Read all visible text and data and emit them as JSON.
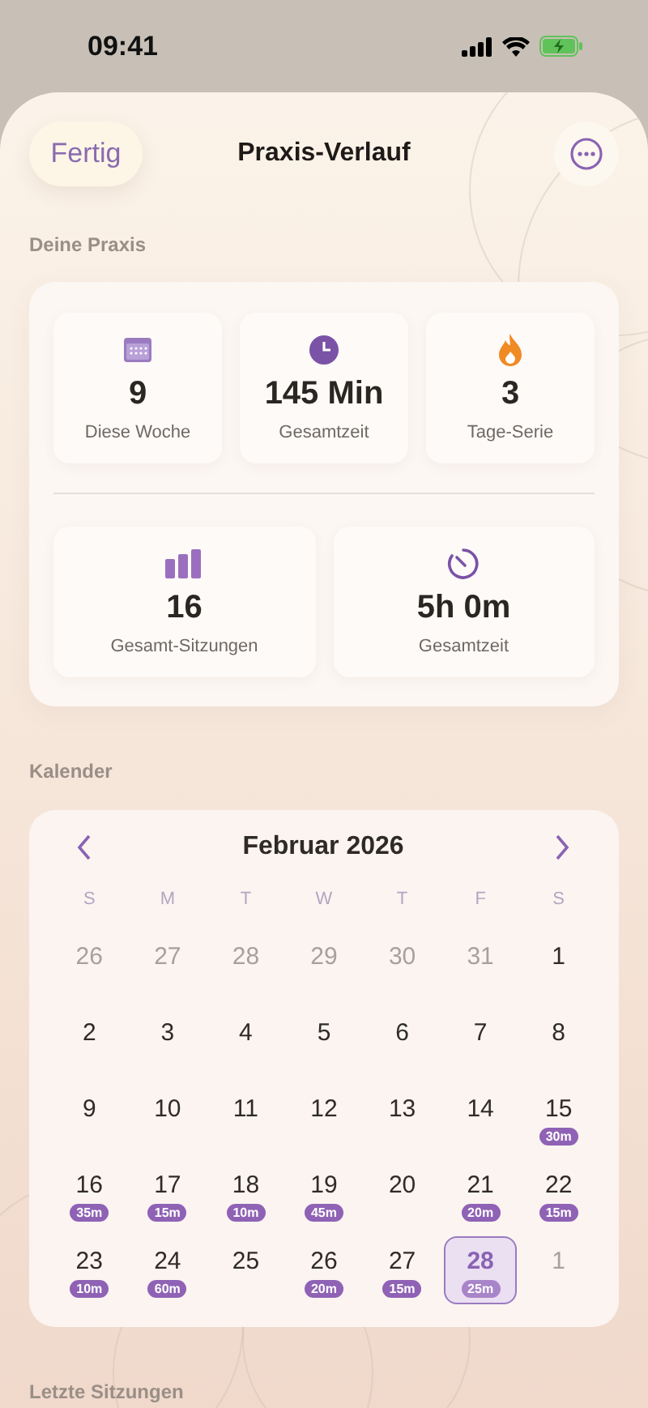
{
  "status_bar": {
    "time": "09:41"
  },
  "header": {
    "done_button": "Fertig",
    "title": "Praxis-Verlauf"
  },
  "practice": {
    "label": "Deine Praxis",
    "top_stats": [
      {
        "kind": "calendar",
        "value": "9",
        "label": "Diese Woche"
      },
      {
        "kind": "clock",
        "value": "145 Min",
        "label": "Gesamtzeit"
      },
      {
        "kind": "flame",
        "value": "3",
        "label": "Tage-Serie"
      }
    ],
    "bottom_stats": [
      {
        "kind": "bars",
        "value": "16",
        "label": "Gesamt-Sitzungen"
      },
      {
        "kind": "timer",
        "value": "5h 0m",
        "label": "Gesamtzeit"
      }
    ]
  },
  "calendar": {
    "label": "Kalender",
    "month": "Februar 2026",
    "weekdays": [
      "S",
      "M",
      "T",
      "W",
      "T",
      "F",
      "S"
    ],
    "days": [
      {
        "day": "26",
        "muted": true,
        "selected": false
      },
      {
        "day": "27",
        "muted": true,
        "selected": false
      },
      {
        "day": "28",
        "muted": true,
        "selected": false
      },
      {
        "day": "29",
        "muted": true,
        "selected": false
      },
      {
        "day": "30",
        "muted": true,
        "selected": false
      },
      {
        "day": "31",
        "muted": true,
        "selected": false
      },
      {
        "day": "1",
        "muted": false,
        "selected": false
      },
      {
        "day": "2",
        "muted": false,
        "selected": false
      },
      {
        "day": "3",
        "muted": false,
        "selected": false
      },
      {
        "day": "4",
        "muted": false,
        "selected": false
      },
      {
        "day": "5",
        "muted": false,
        "selected": false
      },
      {
        "day": "6",
        "muted": false,
        "selected": false
      },
      {
        "day": "7",
        "muted": false,
        "selected": false
      },
      {
        "day": "8",
        "muted": false,
        "selected": false
      },
      {
        "day": "9",
        "muted": false,
        "selected": false
      },
      {
        "day": "10",
        "muted": false,
        "selected": false
      },
      {
        "day": "11",
        "muted": false,
        "selected": false
      },
      {
        "day": "12",
        "muted": false,
        "selected": false
      },
      {
        "day": "13",
        "muted": false,
        "selected": false
      },
      {
        "day": "14",
        "muted": false,
        "selected": false
      },
      {
        "day": "15",
        "badge": "30m",
        "muted": false,
        "selected": false
      },
      {
        "day": "16",
        "badge": "35m",
        "muted": false,
        "selected": false
      },
      {
        "day": "17",
        "badge": "15m",
        "muted": false,
        "selected": false
      },
      {
        "day": "18",
        "badge": "10m",
        "muted": false,
        "selected": false
      },
      {
        "day": "19",
        "badge": "45m",
        "muted": false,
        "selected": false
      },
      {
        "day": "20",
        "muted": false,
        "selected": false
      },
      {
        "day": "21",
        "badge": "20m",
        "muted": false,
        "selected": false
      },
      {
        "day": "22",
        "badge": "15m",
        "muted": false,
        "selected": false
      },
      {
        "day": "23",
        "badge": "10m",
        "muted": false,
        "selected": false
      },
      {
        "day": "24",
        "badge": "60m",
        "muted": false,
        "selected": false
      },
      {
        "day": "25",
        "muted": false,
        "selected": false
      },
      {
        "day": "26",
        "badge": "20m",
        "muted": false,
        "selected": false
      },
      {
        "day": "27",
        "badge": "15m",
        "muted": false,
        "selected": false
      },
      {
        "day": "28",
        "badge": "25m",
        "muted": false,
        "selected": true
      },
      {
        "day": "1",
        "muted": true,
        "selected": false
      }
    ]
  },
  "recent": {
    "label": "Letzte Sitzungen"
  }
}
